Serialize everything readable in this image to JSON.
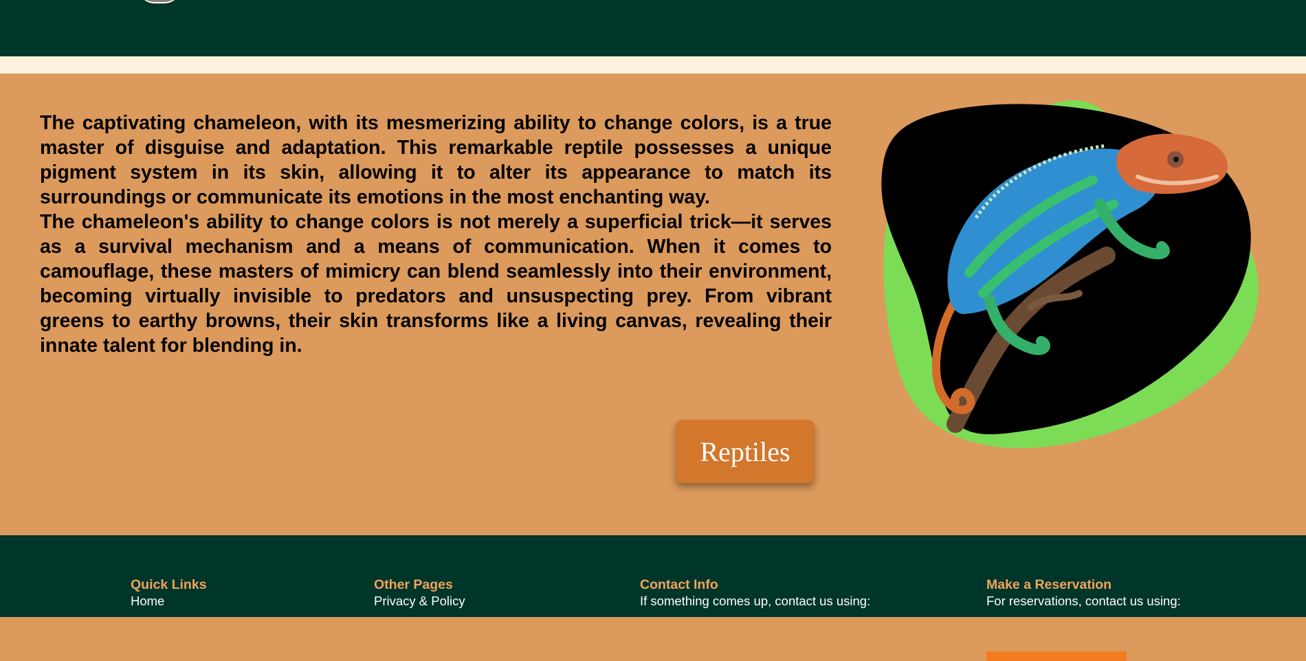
{
  "hero": {
    "paragraphs": [
      "The captivating chameleon, with its mesmerizing ability to change colors, is a true master of disguise and adaptation. This remarkable reptile possesses a unique pigment system in its skin, allowing it to alter its appearance to match its surroundings or communicate its emotions in the most enchanting way.",
      "The chameleon's ability to change colors is not merely a superficial trick—it serves as a survival mechanism and a means of communication. When it comes to camouflage, these masters of mimicry can blend seamlessly into their environment, becoming virtually invisible to predators and unsuspecting prey. From vibrant greens to earthy browns, their skin transforms like a living canvas, revealing their innate talent for blending in."
    ],
    "button_label": "Reptiles"
  },
  "footer": {
    "quick_links": {
      "title": "Quick Links",
      "items": [
        "Home"
      ]
    },
    "other_pages": {
      "title": "Other Pages",
      "items": [
        "Privacy & Policy"
      ]
    },
    "contact": {
      "title": "Contact Info",
      "text": "If something comes up, contact us using:"
    },
    "reservation": {
      "title": "Make a Reservation",
      "text": "For reservations, contact us using:"
    }
  },
  "colors": {
    "header_bg": "#00352a",
    "strip": "#fff3df",
    "hero_bg": "#dc9a5c",
    "button": "#d3772d",
    "blob_green": "#7ddc55",
    "footer_heading": "#f2a35c",
    "reservation_bar": "#f47c20"
  }
}
